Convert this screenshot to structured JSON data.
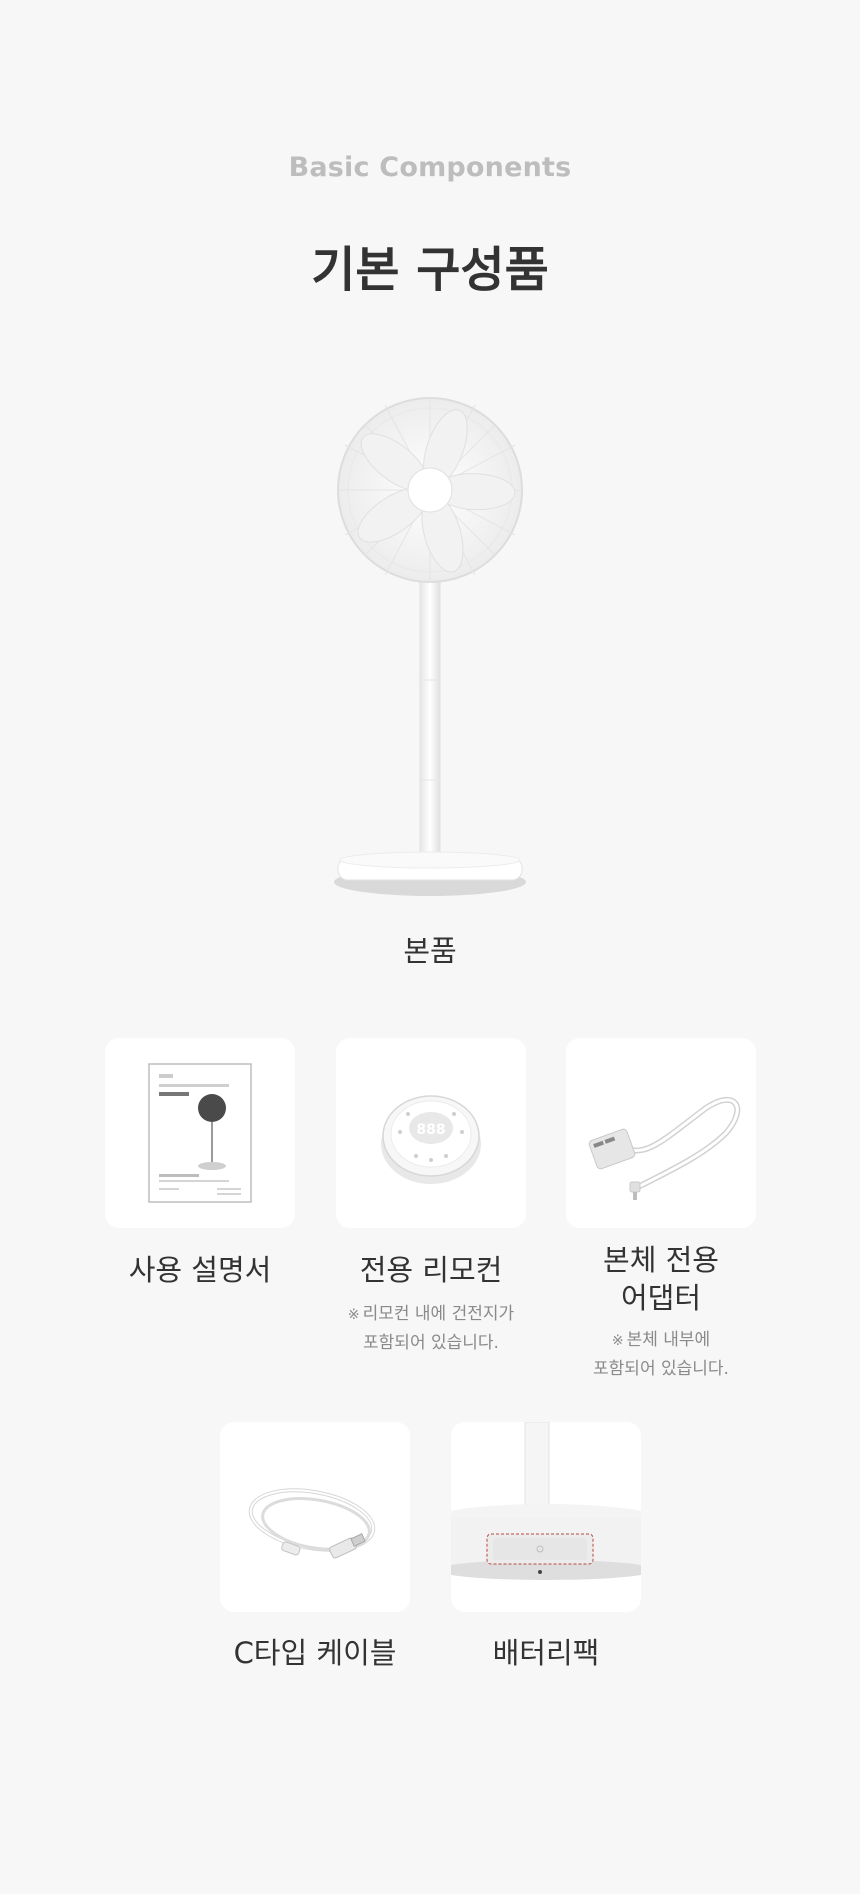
{
  "header": {
    "eyebrow": "Basic Components",
    "title": "기본 구성품"
  },
  "main_product": {
    "label": "본품"
  },
  "components": [
    {
      "label": "사용 설명서",
      "icon": "manual-icon"
    },
    {
      "label": "전용 리모컨",
      "note_line1": "리모컨 내에 건전지가",
      "note_line2": "포함되어 있습니다.",
      "icon": "remote-icon"
    },
    {
      "label_line1": "본체 전용",
      "label_line2": "어댑터",
      "note_line1": "본체 내부에",
      "note_line2": "포함되어 있습니다.",
      "icon": "adapter-icon"
    },
    {
      "label": "C타입 케이블",
      "icon": "usb-c-cable-icon"
    },
    {
      "label": "배터리팩",
      "icon": "battery-pack-icon"
    }
  ],
  "note_mark": "※",
  "colors": {
    "background": "#f7f7f7",
    "card": "#ffffff",
    "eyebrow": "#bdbdbd",
    "text": "#333333",
    "note": "#8a8a8a"
  }
}
